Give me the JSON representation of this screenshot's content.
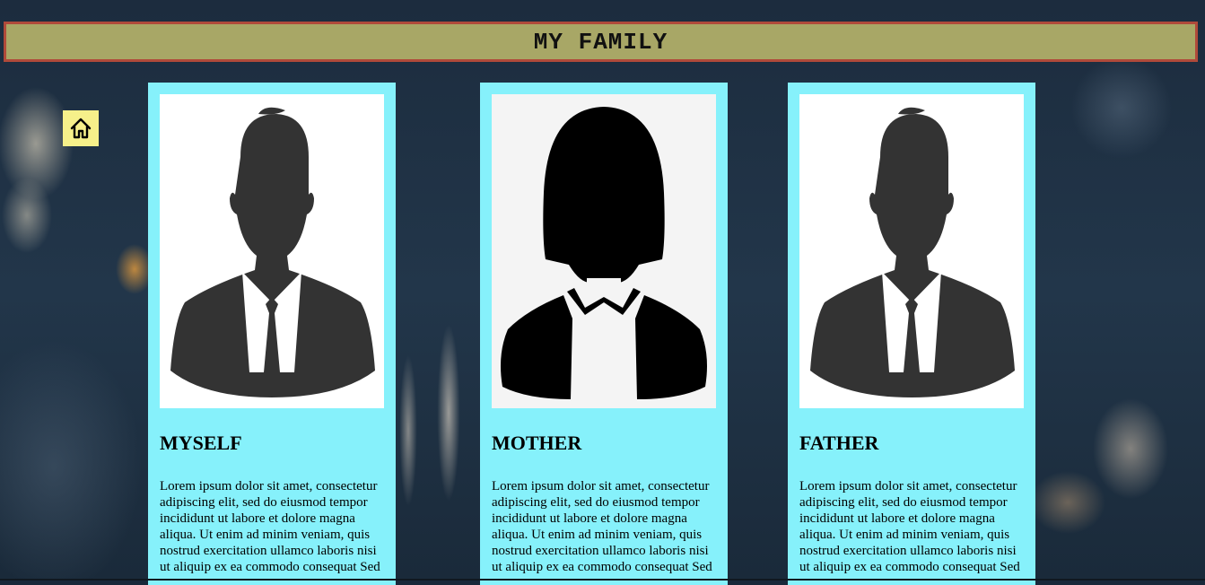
{
  "header": {
    "title": "MY FAMILY"
  },
  "nav": {
    "home_icon": "home-icon"
  },
  "cards": [
    {
      "name": "MYSELF",
      "icon": "male-avatar-icon",
      "text": "Lorem ipsum dolor sit amet, consectetur adipiscing elit, sed do eiusmod tempor incididunt ut labore et dolore magna aliqua. Ut enim ad minim veniam, quis nostrud exercitation ullamco laboris nisi ut aliquip ex ea commodo consequat Sed"
    },
    {
      "name": "MOTHER",
      "icon": "female-avatar-icon",
      "text": "Lorem ipsum dolor sit amet, consectetur adipiscing elit, sed do eiusmod tempor incididunt ut labore et dolore magna aliqua. Ut enim ad minim veniam, quis nostrud exercitation ullamco laboris nisi ut aliquip ex ea commodo consequat Sed"
    },
    {
      "name": "FATHER",
      "icon": "male-avatar-icon",
      "text": "Lorem ipsum dolor sit amet, consectetur adipiscing elit, sed do eiusmod tempor incididunt ut labore et dolore magna aliqua. Ut enim ad minim veniam, quis nostrud exercitation ullamco laboris nisi ut aliquip ex ea commodo consequat Sed"
    }
  ],
  "colors": {
    "banner_bg": "#a8a766",
    "banner_border": "#b04a3a",
    "card_bg": "#86f1fb",
    "home_bg": "#f6f08a"
  }
}
